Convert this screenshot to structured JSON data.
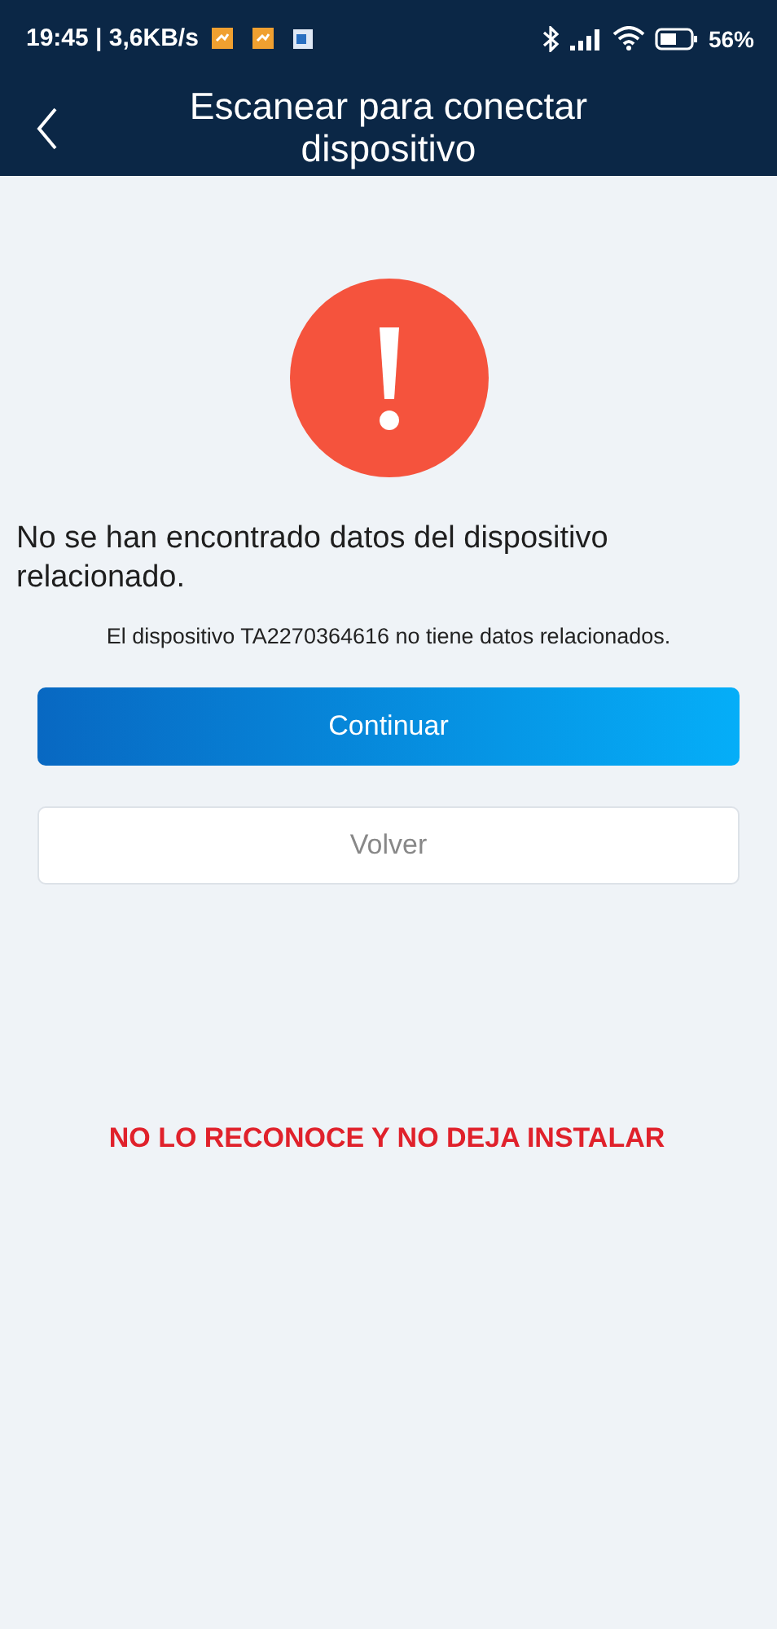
{
  "status_bar": {
    "time": "19:45 | 3,6KB/s",
    "battery": "56%"
  },
  "header": {
    "title": "Escanear para conectar dispositivo"
  },
  "message": "No se han encontrado datos del dispositivo relacionado.",
  "detail": "El dispositivo TA2270364616 no tiene datos relacionados.",
  "buttons": [
    {
      "label": "Continuar",
      "kind": "primary"
    },
    {
      "label": "Volver",
      "kind": "secondary"
    }
  ],
  "annotation": "NO LO RECONOCE Y NO DEJA INSTALAR"
}
